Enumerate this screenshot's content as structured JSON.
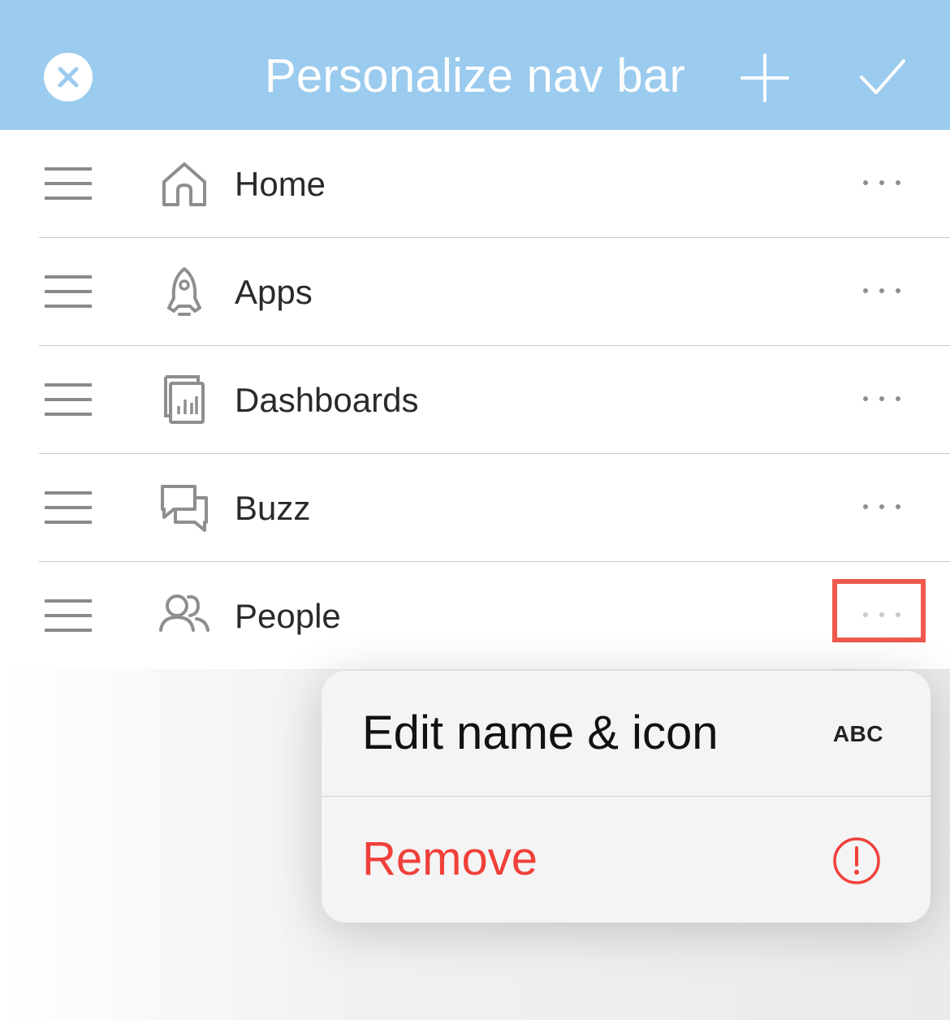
{
  "header": {
    "title": "Personalize nav bar",
    "background": "#9bcbee"
  },
  "nav_items": [
    {
      "label": "Home",
      "icon": "home-icon"
    },
    {
      "label": "Apps",
      "icon": "rocket-icon"
    },
    {
      "label": "Dashboards",
      "icon": "dashboard-icon"
    },
    {
      "label": "Buzz",
      "icon": "chat-bubbles-icon"
    },
    {
      "label": "People",
      "icon": "people-icon"
    }
  ],
  "context_menu": {
    "edit_label": "Edit name & icon",
    "edit_badge": "ABC",
    "remove_label": "Remove",
    "remove_color": "#f0403a"
  },
  "highlight_color": "#ef5a4e"
}
